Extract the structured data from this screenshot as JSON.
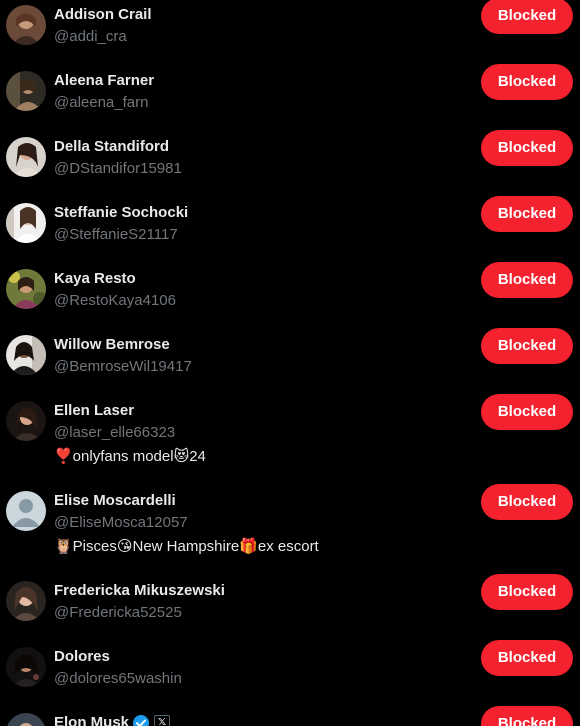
{
  "blocked_label": "Blocked",
  "accounts": [
    {
      "name": "Addison Crail",
      "handle": "@addi_cra",
      "bio": ""
    },
    {
      "name": "Aleena Farner",
      "handle": "@aleena_farn",
      "bio": ""
    },
    {
      "name": "Della Standiford",
      "handle": "@DStandifor15981",
      "bio": ""
    },
    {
      "name": "Steffanie Sochocki",
      "handle": "@SteffanieS21117",
      "bio": ""
    },
    {
      "name": "Kaya Resto",
      "handle": "@RestoKaya4106",
      "bio": ""
    },
    {
      "name": "Willow Bemrose",
      "handle": "@BemroseWil19417",
      "bio": ""
    },
    {
      "name": "Ellen Laser",
      "handle": "@laser_elle66323",
      "bio": "❣️onlyfans model😻24"
    },
    {
      "name": "Elise Moscardelli",
      "handle": "@EliseMosca12057",
      "bio": "🦉Pisces😘New Hampshire🎁ex escort"
    },
    {
      "name": "Fredericka Mikuszewski",
      "handle": "@Fredericka52525",
      "bio": ""
    },
    {
      "name": "Dolores",
      "handle": "@dolores65washin",
      "bio": ""
    },
    {
      "name": "Elon Musk",
      "handle": "",
      "bio": ""
    }
  ],
  "colors": {
    "background": "#000000",
    "blocked_button": "#f4212e",
    "name_text": "#e7e9ea",
    "handle_text": "#71767b",
    "verified_badge": "#1d9bf0"
  },
  "icons": {
    "verified": "verified-badge-icon",
    "affiliation": "x-affiliation-icon",
    "default_avatar": "default-avatar-icon"
  }
}
